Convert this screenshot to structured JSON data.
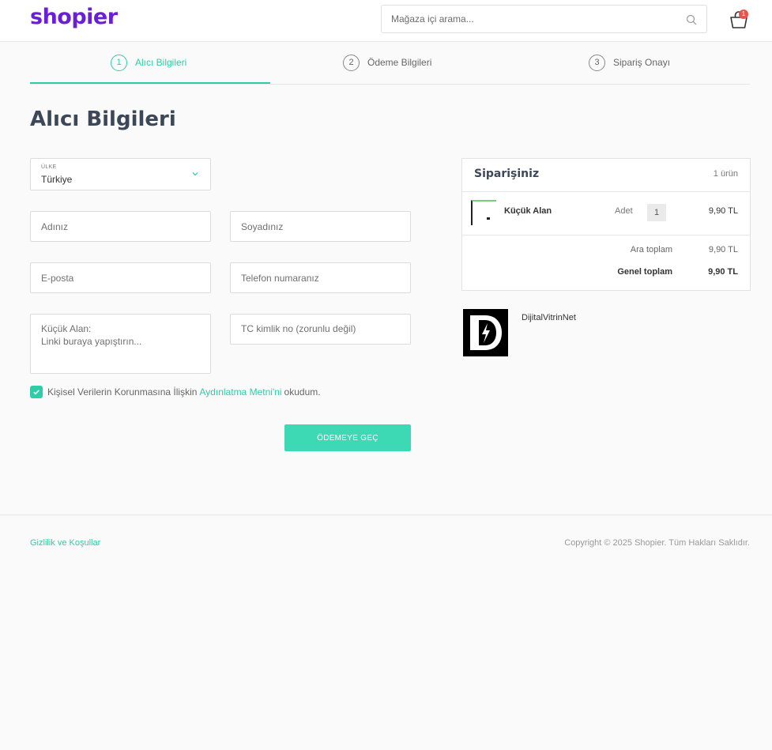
{
  "header": {
    "logo_text": "shopier",
    "search_placeholder": "Mağaza içi arama...",
    "cart_count": "1"
  },
  "steps": [
    {
      "number": "1",
      "label": "Alıcı Bilgileri",
      "active": true
    },
    {
      "number": "2",
      "label": "Ödeme Bilgileri",
      "active": false
    },
    {
      "number": "3",
      "label": "Sipariş Onayı",
      "active": false
    }
  ],
  "page_title": "Alıcı Bilgileri",
  "form": {
    "country_label": "ÜLKE",
    "country_value": "Türkiye",
    "first_name_placeholder": "Adınız",
    "last_name_placeholder": "Soyadınız",
    "email_placeholder": "E-posta",
    "phone_placeholder": "Telefon numaranız",
    "custom_field_label": "Küçük Alan:",
    "custom_field_placeholder": "Linki buraya yapıştırın...",
    "tc_placeholder": "TC kimlik no (zorunlu değil)",
    "consent_prefix": "Kişisel Verilerin Korunmasına İlişkin",
    "consent_link": "Aydınlatma Metni'ni",
    "consent_suffix": "okudum.",
    "consent_checked": true,
    "submit_label": "ÖDEMEYE GEÇ"
  },
  "order": {
    "title": "Siparişiniz",
    "count": "1 ürün",
    "item_name": "Küçük Alan",
    "qty_label": "Adet",
    "qty_value": "1",
    "item_price": "9,90 TL",
    "subtotal_label": "Ara toplam",
    "subtotal_value": "9,90 TL",
    "total_label": "Genel toplam",
    "total_value": "9,90 TL"
  },
  "store": {
    "name": "DijitalVitrinNet"
  },
  "footer": {
    "privacy_link": "Gizlilik ve Koşullar",
    "copyright": "Copyright © 2025 Shopier. Tüm Hakları Saklıdır."
  },
  "colors": {
    "accent": "#2fcca8",
    "brand": "#6a1fd6",
    "badge": "#e8534e"
  }
}
